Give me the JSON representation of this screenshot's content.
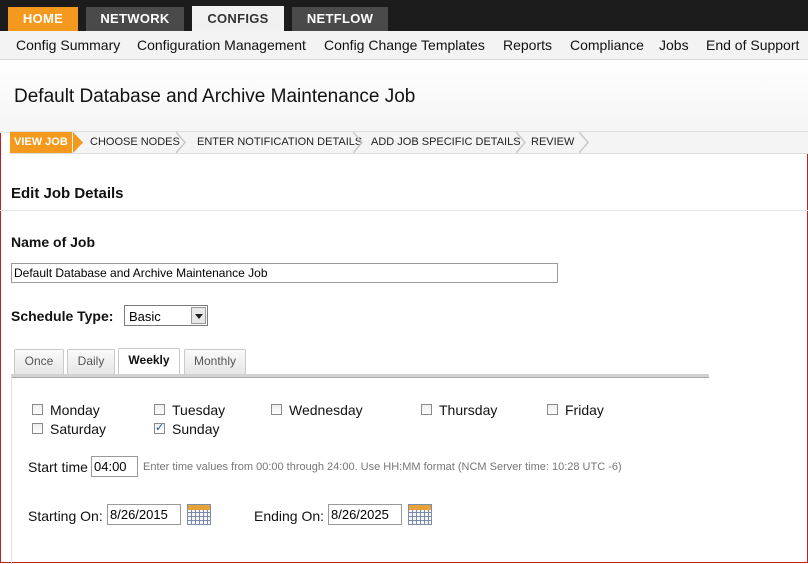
{
  "top_tabs": [
    {
      "label": "HOME"
    },
    {
      "label": "NETWORK"
    },
    {
      "label": "CONFIGS"
    },
    {
      "label": "NETFLOW"
    }
  ],
  "submenu": [
    "Config Summary",
    "Configuration Management",
    "Config Change Templates",
    "Reports",
    "Compliance",
    "Jobs",
    "End of Support"
  ],
  "page_title": "Default Database and Archive Maintenance Job",
  "wizard_steps": [
    "VIEW JOB",
    "CHOOSE NODES",
    "ENTER NOTIFICATION DETAILS",
    "ADD JOB SPECIFIC DETAILS",
    "REVIEW"
  ],
  "section_title": "Edit Job Details",
  "job_name": {
    "label": "Name of Job",
    "value": "Default Database and Archive Maintenance Job"
  },
  "schedule_type": {
    "label": "Schedule Type:",
    "value": "Basic"
  },
  "schedule_tabs": [
    "Once",
    "Daily",
    "Weekly",
    "Monthly"
  ],
  "days": [
    {
      "label": "Monday",
      "checked": false
    },
    {
      "label": "Tuesday",
      "checked": false
    },
    {
      "label": "Wednesday",
      "checked": false
    },
    {
      "label": "Thursday",
      "checked": false
    },
    {
      "label": "Friday",
      "checked": false
    },
    {
      "label": "Saturday",
      "checked": false
    },
    {
      "label": "Sunday",
      "checked": true
    }
  ],
  "start_time": {
    "label": "Start time",
    "value": "04:00",
    "hint": "Enter time values from 00:00 through 24:00. Use HH:MM format (NCM Server time: 10:28 UTC -6)"
  },
  "starting_on": {
    "label": "Starting On:",
    "value": "8/26/2015"
  },
  "ending_on": {
    "label": "Ending On:",
    "value": "8/26/2025"
  },
  "colors": {
    "accent_orange": "#f39a1e",
    "top_bar": "#1c1c1c",
    "inactive_tab": "#4a4a4a"
  }
}
